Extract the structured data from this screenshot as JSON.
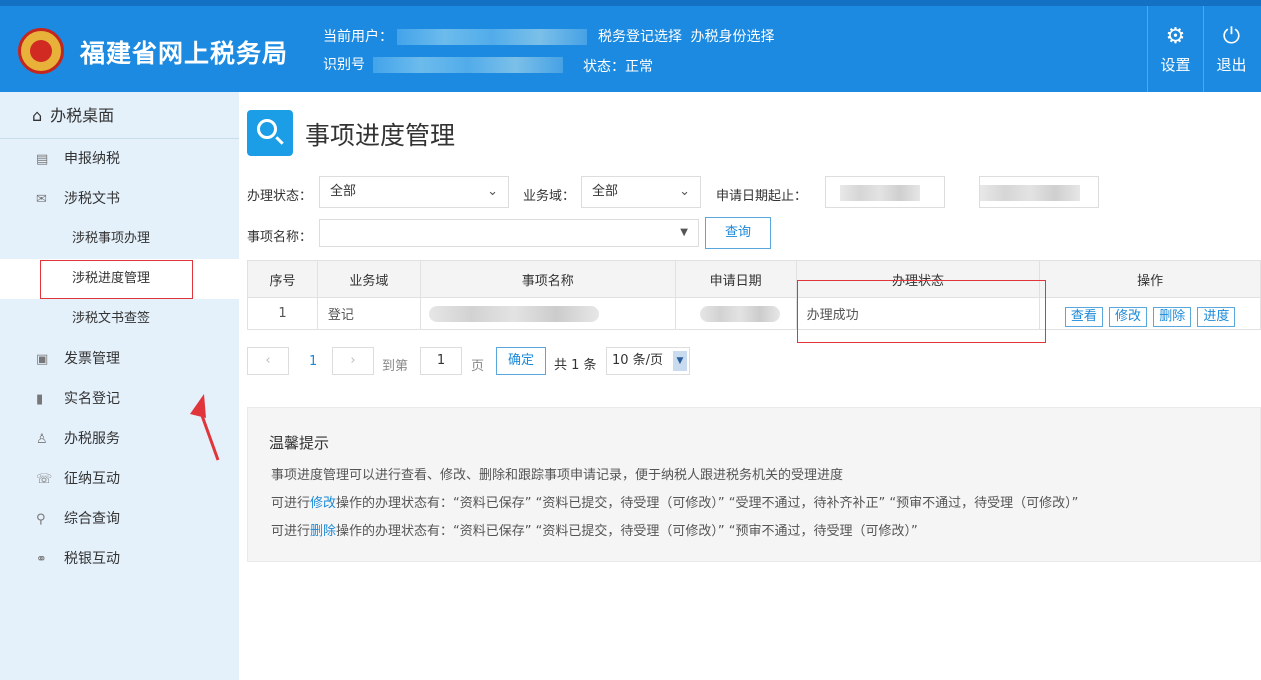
{
  "header": {
    "site_title": "福建省网上税务局",
    "current_user_label": "当前用户：",
    "id_label": "识别号",
    "tax_reg_select": "税务登记选择",
    "tax_identity_select": "办税身份选择",
    "status_text": "状态：正常",
    "settings_label": "设置",
    "logout_label": "退出",
    "settings_icon": "gear-icon",
    "logout_icon": "power-icon"
  },
  "sidebar": {
    "home": "办税桌面",
    "items": [
      {
        "label": "申报纳税",
        "icon": "declare-icon"
      },
      {
        "label": "涉税文书",
        "icon": "document-icon"
      },
      {
        "label": "发票管理",
        "icon": "invoice-icon"
      },
      {
        "label": "实名登记",
        "icon": "realname-icon"
      },
      {
        "label": "办税服务",
        "icon": "service-icon"
      },
      {
        "label": "征纳互动",
        "icon": "chat-icon"
      },
      {
        "label": "综合查询",
        "icon": "search-icon"
      },
      {
        "label": "税银互动",
        "icon": "handshake-icon"
      }
    ],
    "sub_items": [
      "涉税事项办理",
      "涉税进度管理",
      "涉税文书查签"
    ]
  },
  "main": {
    "title": "事项进度管理",
    "filters": {
      "status_label": "办理状态：",
      "status_value": "全部",
      "domain_label": "业务域：",
      "domain_value": "全部",
      "date_label": "申请日期起止：",
      "name_label": "事项名称：",
      "query_button": "查询"
    },
    "table": {
      "headers": [
        "序号",
        "业务域",
        "事项名称",
        "申请日期",
        "办理状态",
        "操作"
      ],
      "rows": [
        {
          "index": "1",
          "domain": "登记",
          "status": "办理成功"
        }
      ],
      "actions": [
        "查看",
        "修改",
        "删除",
        "进度"
      ]
    },
    "pager": {
      "prev": "‹",
      "current_page": "1",
      "next": "›",
      "goto_label": "到第",
      "page_input": "1",
      "page_unit": "页",
      "confirm": "确定",
      "total": "共 1 条",
      "page_size": "10 条/页"
    },
    "tips": {
      "title": "温馨提示",
      "line1": "事项进度管理可以进行查看、修改、删除和跟踪事项申请记录，便于纳税人跟进税务机关的受理进度",
      "line2_prefix": "可进行",
      "line2_link": "修改",
      "line2_rest": "操作的办理状态有：“资料已保存”   “资料已提交，待受理（可修改）”   “受理不通过，待补齐补正”   “预审不通过，待受理（可修改）”",
      "line3_prefix": "可进行",
      "line3_link": "删除",
      "line3_rest": "操作的办理状态有：“资料已保存”   “资料已提交，待受理（可修改）”   “预审不通过，待受理（可修改）”"
    }
  },
  "colors": {
    "header_blue": "#1c8ae0",
    "sidebar_bg": "#e4f1fb",
    "accent": "#1b8ad8",
    "highlight_red": "#e0353a"
  }
}
